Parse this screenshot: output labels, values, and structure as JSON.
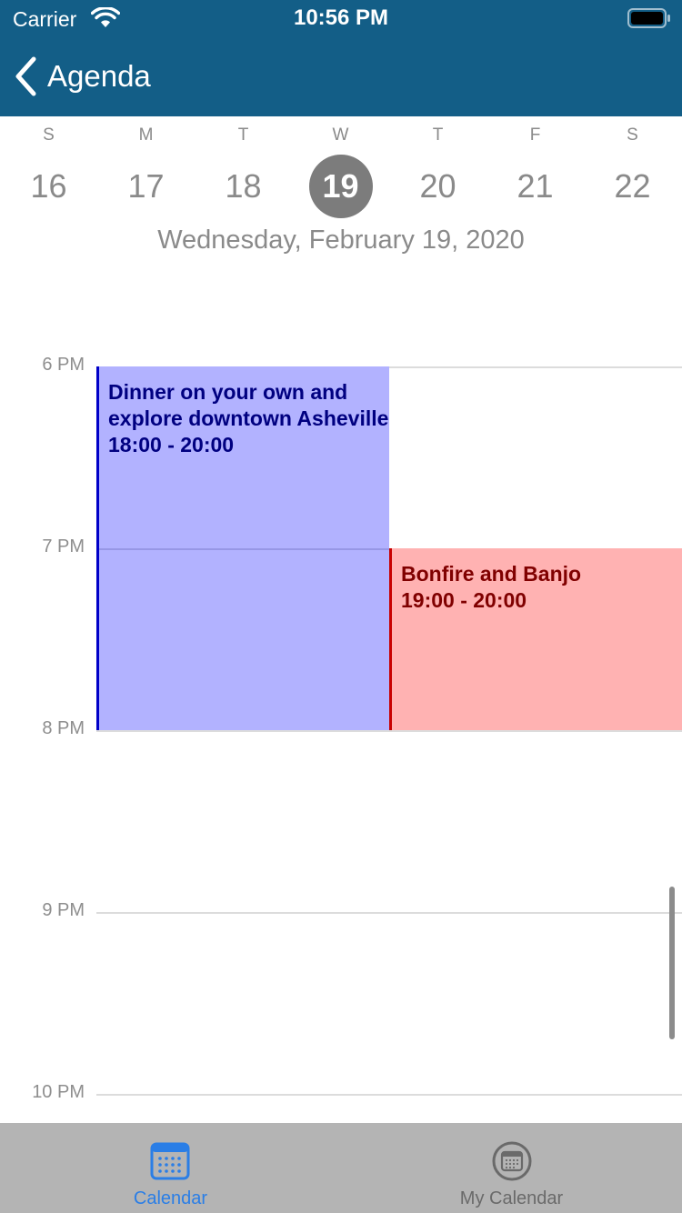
{
  "status_bar": {
    "carrier": "Carrier",
    "time": "10:56 PM"
  },
  "nav": {
    "back_label": "Agenda"
  },
  "week": {
    "days": [
      {
        "letter": "S",
        "number": "16"
      },
      {
        "letter": "M",
        "number": "17"
      },
      {
        "letter": "T",
        "number": "18"
      },
      {
        "letter": "W",
        "number": "19",
        "selected": true
      },
      {
        "letter": "T",
        "number": "20"
      },
      {
        "letter": "F",
        "number": "21"
      },
      {
        "letter": "S",
        "number": "22"
      }
    ],
    "selected_date_title": "Wednesday, February 19, 2020"
  },
  "timeline": {
    "hours": [
      "6 PM",
      "7 PM",
      "8 PM",
      "9 PM",
      "10 PM"
    ]
  },
  "events": [
    {
      "title": "Dinner on your own and explore downtown Asheville",
      "time": "18:00 - 20:00",
      "color": "#b2b2ff",
      "accent": "#0000c8"
    },
    {
      "title": "Bonfire and Banjo",
      "time": "19:00 - 20:00",
      "color": "#ffb2b2",
      "accent": "#c80000"
    }
  ],
  "tabbar": {
    "tabs": [
      {
        "label": "Calendar",
        "active": true,
        "icon": "calendar-icon"
      },
      {
        "label": "My Calendar",
        "active": false,
        "icon": "my-calendar-icon"
      }
    ]
  },
  "colors": {
    "header": "#135e87",
    "tab_active": "#2a7ee6",
    "tabbar_bg": "#b4b4b4"
  }
}
